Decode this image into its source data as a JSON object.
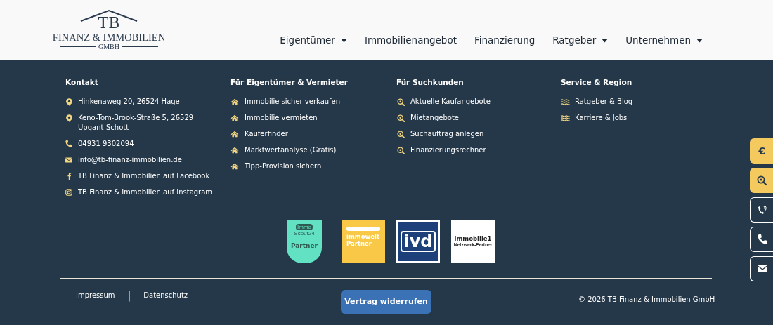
{
  "logo": {
    "initials": "TB",
    "name": "FINANZ & IMMOBILIEN",
    "suffix": "GMBH"
  },
  "nav": [
    {
      "label": "Eigentümer",
      "dropdown": true
    },
    {
      "label": "Immobilienangebot",
      "dropdown": false
    },
    {
      "label": "Finanzierung",
      "dropdown": false
    },
    {
      "label": "Ratgeber",
      "dropdown": true
    },
    {
      "label": "Unternehmen",
      "dropdown": true
    }
  ],
  "columns": [
    {
      "title": "Kontakt",
      "items": [
        {
          "kind": "address",
          "text": "Hinkenaweg 20, 26524 Hage"
        },
        {
          "kind": "address",
          "text": "Keno-Tom-Brook-Straße 5, 26529 Upgant-Schott"
        },
        {
          "kind": "phone",
          "text": "04931 9302094"
        },
        {
          "kind": "email",
          "text": "info@tb-finanz-immobilien.de"
        },
        {
          "kind": "facebook",
          "text": "TB Finanz & Immobilien auf Facebook"
        },
        {
          "kind": "instagram",
          "text": "TB Finanz & Immobilien auf Instagram"
        }
      ]
    },
    {
      "title": "Für Eigentümer & Vermieter",
      "items": [
        {
          "kind": "owner",
          "text": "Immobilie sicher verkaufen"
        },
        {
          "kind": "owner",
          "text": "Immobilie vermieten"
        },
        {
          "kind": "owner",
          "text": "Käuferfinder"
        },
        {
          "kind": "owner",
          "text": "Marktwertanalyse (Gratis)"
        },
        {
          "kind": "owner",
          "text": "Tipp-Provision sichern"
        }
      ]
    },
    {
      "title": "Für Suchkunden",
      "items": [
        {
          "kind": "search",
          "text": "Aktuelle Kaufangebote"
        },
        {
          "kind": "search",
          "text": "Mietangebote"
        },
        {
          "kind": "search",
          "text": "Suchauftrag anlegen"
        },
        {
          "kind": "search",
          "text": "Finanzierungsrechner"
        }
      ]
    },
    {
      "title": "Service & Region",
      "items": [
        {
          "kind": "region",
          "text": "Ratgeber & Blog"
        },
        {
          "kind": "region",
          "text": "Karriere & Jobs"
        }
      ]
    }
  ],
  "badges": [
    {
      "kind": "immoscout",
      "texts": [
        "Immo",
        "Scout24",
        "Partner"
      ]
    },
    {
      "kind": "immowelt",
      "texts": [
        "immowelt",
        "Partner"
      ]
    },
    {
      "kind": "ivd",
      "texts": [
        "ivd"
      ]
    },
    {
      "kind": "immobilie1",
      "texts": [
        "immobilie1",
        "Netzwerk-Partner"
      ]
    }
  ],
  "legal_links": [
    "Impressum",
    "Datenschutz"
  ],
  "separator": "|",
  "revoke_button": "Vertrag widerrufen",
  "copyright": "© 2026 TB Finanz & Immobilien GmbH",
  "side_buttons": [
    {
      "kind": "euro",
      "highlighted": true,
      "label": "€"
    },
    {
      "kind": "search",
      "highlighted": true
    },
    {
      "kind": "callback",
      "highlighted": false
    },
    {
      "kind": "phone",
      "highlighted": false
    },
    {
      "kind": "email",
      "highlighted": false
    }
  ]
}
